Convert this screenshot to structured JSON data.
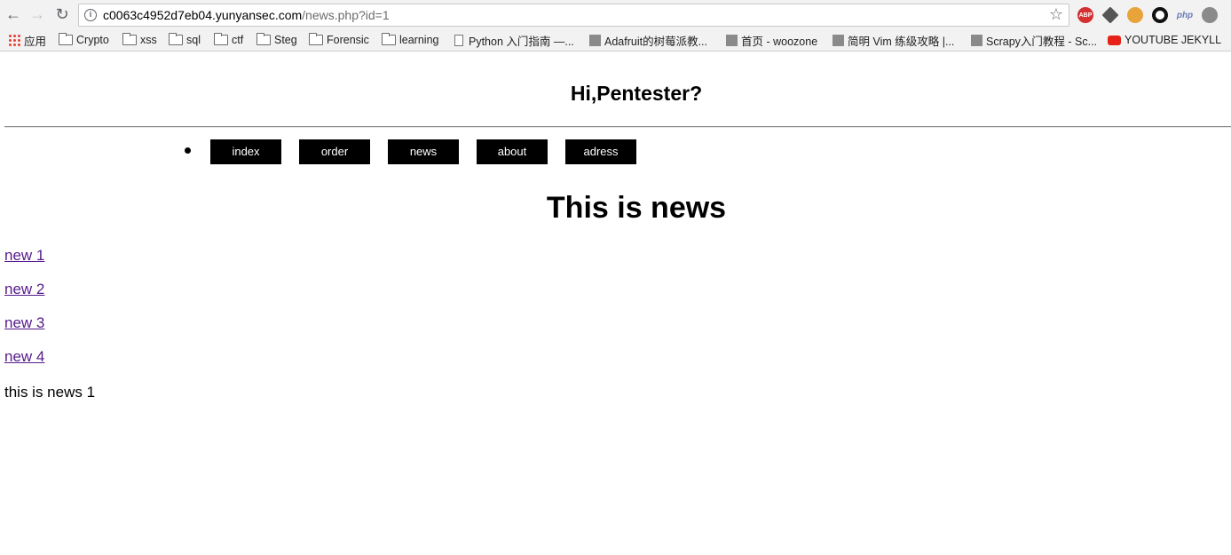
{
  "browser": {
    "url_host": "c0063c4952d7eb04.yunyansec.com",
    "url_path": "/news.php?id=1",
    "back_icon": "back-arrow-icon",
    "forward_icon": "forward-arrow-icon",
    "reload_icon": "reload-icon",
    "extensions": [
      {
        "name": "adblock-plus-icon",
        "label": "ABP",
        "color": "#d3302f"
      },
      {
        "name": "diamond-extension-icon",
        "label": "",
        "color": "#555555"
      },
      {
        "name": "cookie-extension-icon",
        "label": "",
        "color": "#e8a33b"
      },
      {
        "name": "ring-extension-icon",
        "label": "",
        "color": "#111111"
      },
      {
        "name": "php-extension-icon",
        "label": "php",
        "color": "#6b7fb8"
      },
      {
        "name": "settings-extension-icon",
        "label": "",
        "color": "#8a8a8a"
      }
    ]
  },
  "bookmarks": [
    {
      "label": "应用",
      "icon": "apps"
    },
    {
      "label": "Crypto",
      "icon": "folder"
    },
    {
      "label": "xss",
      "icon": "folder"
    },
    {
      "label": "sql",
      "icon": "folder"
    },
    {
      "label": "ctf",
      "icon": "folder"
    },
    {
      "label": "Steg",
      "icon": "folder"
    },
    {
      "label": "Forensic",
      "icon": "folder"
    },
    {
      "label": "learning",
      "icon": "folder"
    },
    {
      "label": "Python 入门指南 —...",
      "icon": "page"
    },
    {
      "label": "Adafruit的树莓派教...",
      "icon": "site"
    },
    {
      "label": "首页 - woozone",
      "icon": "site"
    },
    {
      "label": "简明 Vim 练级攻略 |...",
      "icon": "site"
    },
    {
      "label": "Scrapy入门教程 - Sc...",
      "icon": "site"
    },
    {
      "label": "YOUTUBE JEKYLL",
      "icon": "youtube"
    }
  ],
  "site": {
    "title": "Hi,Pentester?",
    "menu": [
      "index",
      "order",
      "news",
      "about",
      "adress"
    ],
    "heading": "This is news",
    "links": [
      "new 1",
      "new 2",
      "new 3",
      "new 4"
    ],
    "body": "this is news 1"
  }
}
